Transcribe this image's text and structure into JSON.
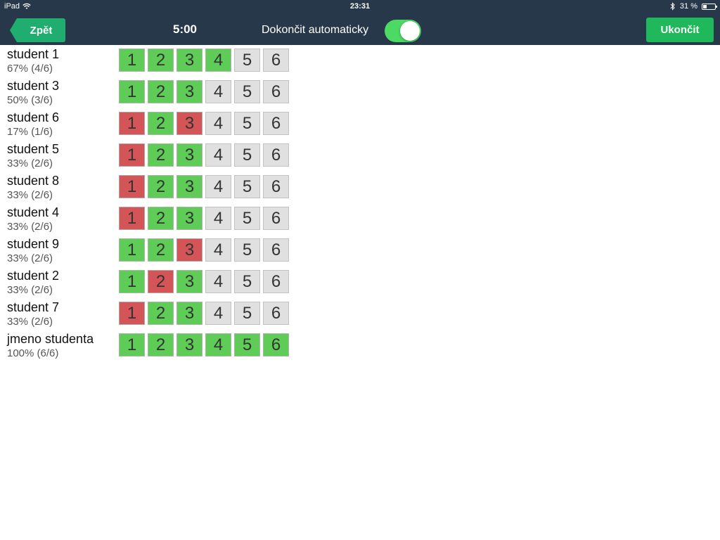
{
  "status_bar": {
    "device": "iPad",
    "time": "23:31",
    "battery": "31 %",
    "battery_level": 0.31,
    "icons": [
      "wifi-icon",
      "bluetooth-icon",
      "battery-icon"
    ]
  },
  "nav": {
    "back_label": "Zpět",
    "timer": "5:00",
    "auto_finish_label": "Dokončit automaticky",
    "auto_finish_on": true,
    "finish_label": "Ukončit"
  },
  "colors": {
    "topbar": "#26384a",
    "back_button": "#1fae6f",
    "finish_button": "#1fb85a",
    "toggle_on": "#4cd964",
    "correct": "#5fcc58",
    "wrong": "#d35557",
    "unanswered": "#e0e0e0"
  },
  "students": [
    {
      "name": "student 1",
      "score": "67% (4/6)",
      "answers": [
        "correct",
        "correct",
        "correct",
        "correct",
        "none",
        "none"
      ]
    },
    {
      "name": "student 3",
      "score": "50% (3/6)",
      "answers": [
        "correct",
        "correct",
        "correct",
        "none",
        "none",
        "none"
      ]
    },
    {
      "name": "student 6",
      "score": "17% (1/6)",
      "answers": [
        "wrong",
        "correct",
        "wrong",
        "none",
        "none",
        "none"
      ]
    },
    {
      "name": "student 5",
      "score": "33% (2/6)",
      "answers": [
        "wrong",
        "correct",
        "correct",
        "none",
        "none",
        "none"
      ]
    },
    {
      "name": "student 8",
      "score": "33% (2/6)",
      "answers": [
        "wrong",
        "correct",
        "correct",
        "none",
        "none",
        "none"
      ]
    },
    {
      "name": "student 4",
      "score": "33% (2/6)",
      "answers": [
        "wrong",
        "correct",
        "correct",
        "none",
        "none",
        "none"
      ]
    },
    {
      "name": "student 9",
      "score": "33% (2/6)",
      "answers": [
        "correct",
        "correct",
        "wrong",
        "none",
        "none",
        "none"
      ]
    },
    {
      "name": "student 2",
      "score": "33% (2/6)",
      "answers": [
        "correct",
        "wrong",
        "correct",
        "none",
        "none",
        "none"
      ]
    },
    {
      "name": "student 7",
      "score": "33% (2/6)",
      "answers": [
        "wrong",
        "correct",
        "correct",
        "none",
        "none",
        "none"
      ]
    },
    {
      "name": "jmeno studenta",
      "score": "100% (6/6)",
      "answers": [
        "correct",
        "correct",
        "correct",
        "correct",
        "correct",
        "correct"
      ]
    }
  ],
  "question_numbers": [
    "1",
    "2",
    "3",
    "4",
    "5",
    "6"
  ]
}
